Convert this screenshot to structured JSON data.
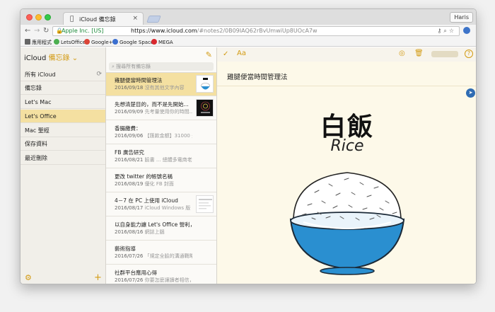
{
  "browser": {
    "tab_title": "iCloud 備忘錄",
    "profile": "Haris",
    "secure_label": "Apple Inc. [US]",
    "url_host": "https://www.icloud.com",
    "url_path": "/#notes2/0B09IAQ62rBvUmwiUp8UOcA7w",
    "bookmarks": [
      {
        "label": "應用程式",
        "color": "#555555"
      },
      {
        "label": "LetsOffice",
        "color": "#4caf50"
      },
      {
        "label": "Google+",
        "color": "#db4437"
      },
      {
        "label": "Google Spaces",
        "color": "#3b6fd0"
      },
      {
        "label": "MEGA",
        "color": "#d9272e"
      }
    ]
  },
  "sidebar": {
    "brand": "iCloud",
    "app_name": "備忘錄",
    "items": [
      {
        "label": "所有 iCloud"
      },
      {
        "label": "備忘錄"
      },
      {
        "label": "Let's Mac"
      },
      {
        "label": "Let's Office"
      },
      {
        "label": "Mac 聖經"
      },
      {
        "label": "保存資料"
      },
      {
        "label": "最近刪除"
      }
    ]
  },
  "notelist": {
    "search_placeholder": "搜尋所有備忘錄",
    "notes": [
      {
        "title": "雞腿便當時間管理法",
        "date": "2016/09/18",
        "snippet": "沒有其他文字內容"
      },
      {
        "title": "先想清楚目的，而不是先開始...",
        "date": "2016/09/09",
        "snippet": "先考量使用你的時間..."
      },
      {
        "title": "香腸繳費：",
        "date": "2016/09/06",
        "snippet": "【匯款金額】31000 元"
      },
      {
        "title": "FB 廣告研究",
        "date": "2016/08/21",
        "snippet": "臉書 ... 總體多電商老闆們文..."
      },
      {
        "title": "更改 twitter 的帳號名稱",
        "date": "2016/08/19",
        "snippet": "優化 FB 封面"
      },
      {
        "title": "4－7 在 PC 上使用 iCloud",
        "date": "2016/08/17",
        "snippet": "iCloud Windows 版"
      },
      {
        "title": "以自身能力讓 Let's Office 營利，...",
        "date": "2016/08/16",
        "snippet": "網誌上腦"
      },
      {
        "title": "藝術指導",
        "date": "2016/07/26",
        "snippet": "「規定全臉的溝通戰略，運..."
      },
      {
        "title": "社群平台應用心得",
        "date": "2016/07/26",
        "snippet": "你要怎麼讓讀者相信，讀..."
      }
    ]
  },
  "editor": {
    "note_title": "雞腿便當時間管理法",
    "image_title_cn": "白飯",
    "image_title_en": "Rice"
  },
  "colors": {
    "accent": "#d39b13",
    "selection": "#f4e0a1",
    "bowl_blue": "#2a8fd0"
  }
}
